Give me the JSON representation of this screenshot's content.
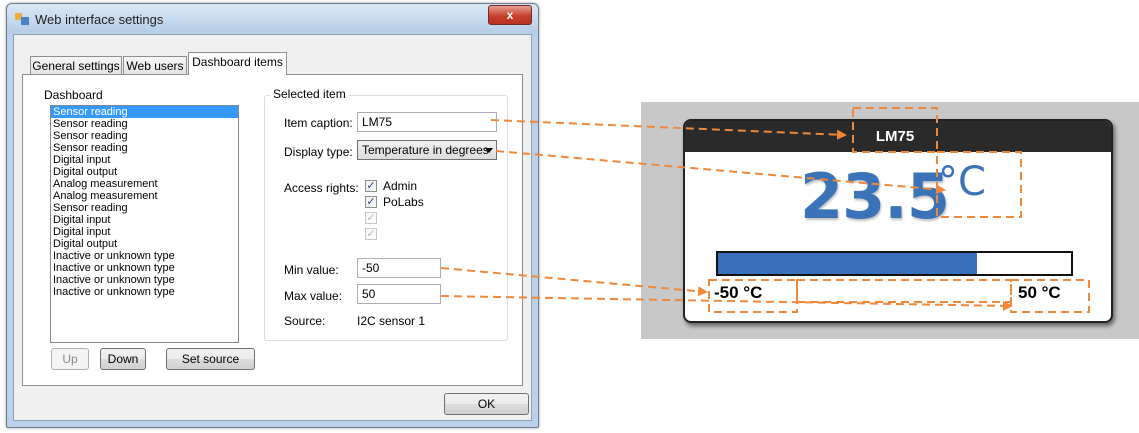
{
  "window": {
    "title": "Web interface settings",
    "close_glyph": "x"
  },
  "tabs": [
    {
      "label": "General settings"
    },
    {
      "label": "Web users"
    },
    {
      "label": "Dashboard items"
    }
  ],
  "dashboard": {
    "label": "Dashboard",
    "items": [
      "Sensor reading",
      "Sensor reading",
      "Sensor reading",
      "Sensor reading",
      "Digital input",
      "Digital output",
      "Analog measurement",
      "Analog measurement",
      "Sensor reading",
      "Digital input",
      "Digital input",
      "Digital output",
      "Inactive or unknown type",
      "Inactive or unknown type",
      "Inactive or unknown type",
      "Inactive or unknown type"
    ],
    "selected_index": 0
  },
  "selected_item": {
    "group_label": "Selected item",
    "caption_label": "Item caption:",
    "caption_value": "LM75",
    "display_type_label": "Display type:",
    "display_type_value": "Temperature in degrees",
    "access_rights_label": "Access rights:",
    "access": [
      {
        "label": "Admin",
        "checked": true,
        "enabled": true
      },
      {
        "label": "PoLabs",
        "checked": true,
        "enabled": true
      },
      {
        "label": "",
        "checked": true,
        "enabled": false
      },
      {
        "label": "",
        "checked": true,
        "enabled": false
      }
    ],
    "min_label": "Min value:",
    "min_value": "-50",
    "max_label": "Max value:",
    "max_value": "50",
    "source_label": "Source:",
    "source_value": "I2C sensor 1"
  },
  "buttons": {
    "up": "Up",
    "down": "Down",
    "set_source": "Set source",
    "ok": "OK"
  },
  "widget": {
    "title": "LM75",
    "value": "23.5",
    "unit": "°C",
    "min_label": "-50 °C",
    "max_label": "50 °C",
    "fill_fraction": 0.735
  },
  "colors": {
    "accent_blue": "#3b73b9",
    "selection": "#3399ff",
    "arrow_orange": "#f0883a",
    "header_dark": "#2a2a2a"
  }
}
